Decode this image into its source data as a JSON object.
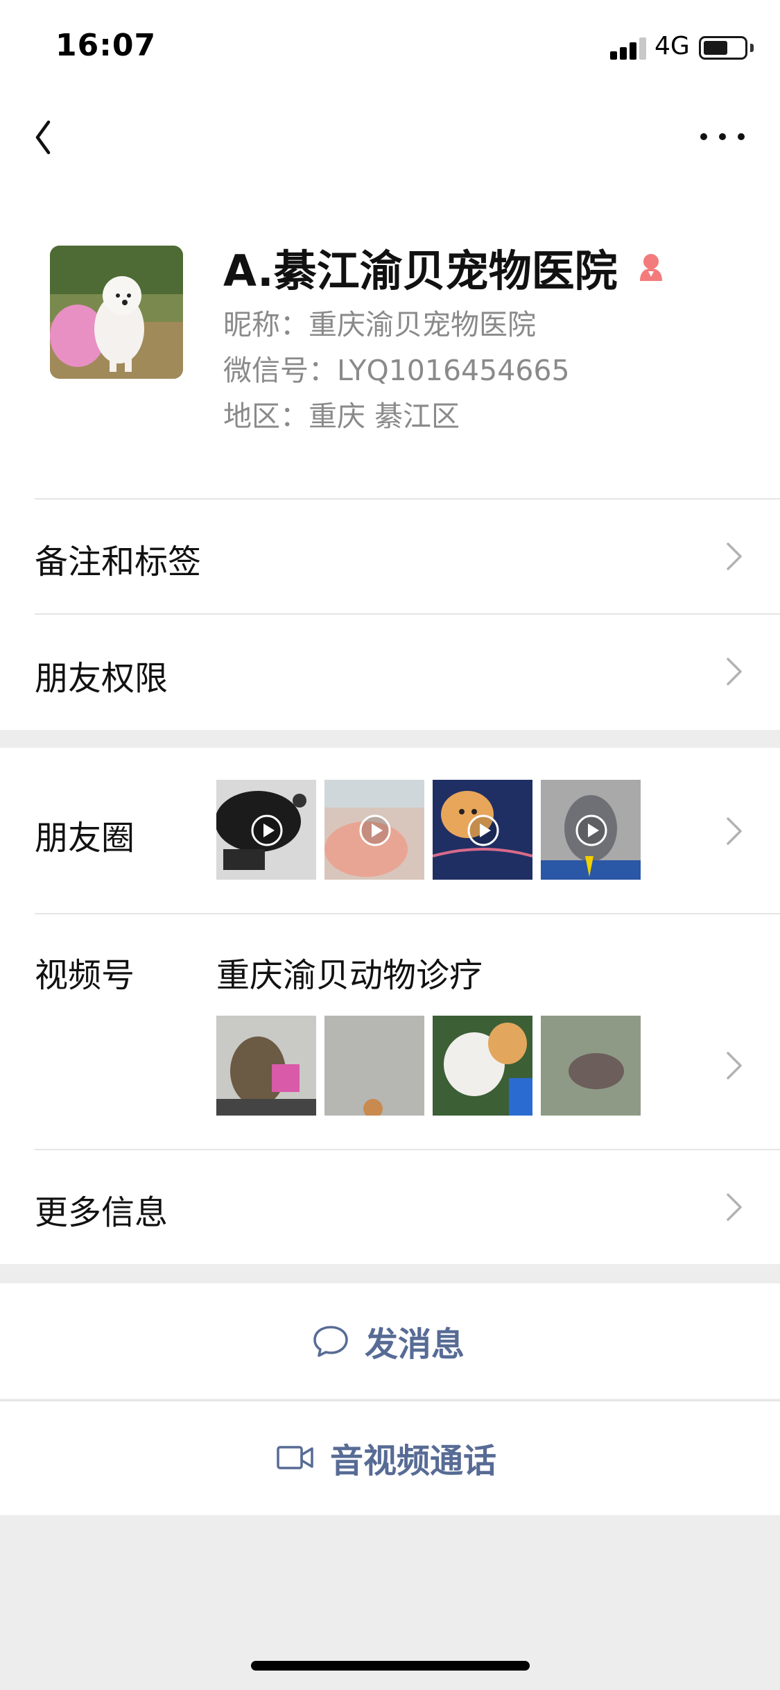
{
  "status_bar": {
    "time": "16:07",
    "network": "4G",
    "signal_icon": "signal-bars-icon",
    "battery_icon": "battery-icon"
  },
  "nav": {
    "back_icon": "chevron-left-icon",
    "more_icon": "ellipsis-icon"
  },
  "profile": {
    "name": "A.綦江渝贝宠物医院",
    "gender_icon": "female-icon",
    "gender_color": "#fa5151",
    "nickname": "昵称：重庆渝贝宠物医院",
    "wechat_id": "微信号：LYQ1016454665",
    "region": "地区：重庆  綦江区"
  },
  "cells": {
    "remarks_tags": "备注和标签",
    "friend_permissions": "朋友权限",
    "moments": "朋友圈",
    "channels": "视频号",
    "channels_name": "重庆渝贝动物诊疗",
    "more_info": "更多信息"
  },
  "actions": {
    "message": "发消息",
    "message_icon": "chat-bubble-icon",
    "call": "音视频通话",
    "call_icon": "video-camera-icon",
    "accent_color": "#576b95"
  }
}
